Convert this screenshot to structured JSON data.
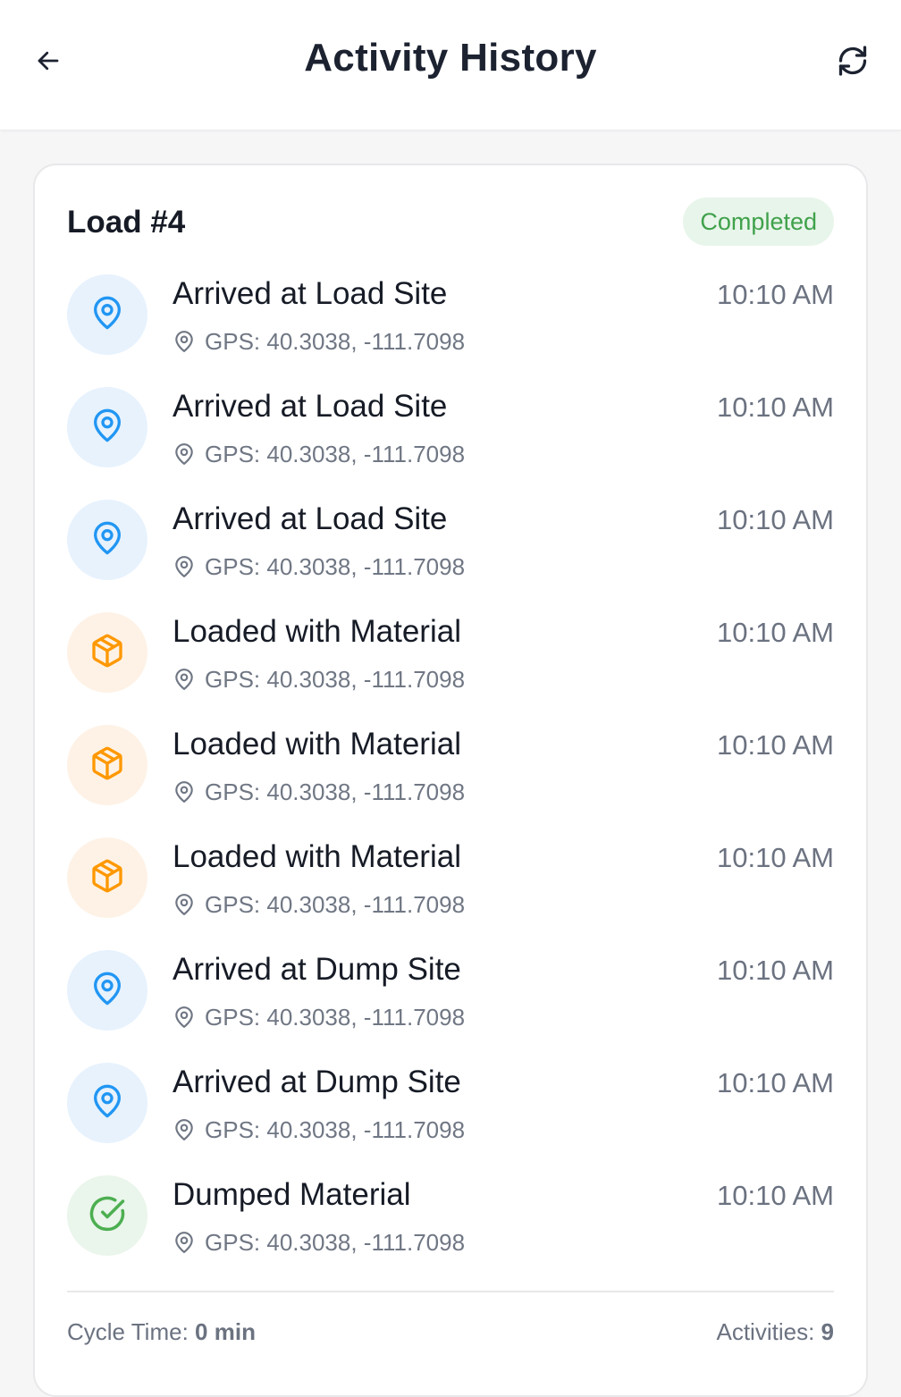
{
  "header": {
    "title": "Activity History",
    "back_icon": "arrow-left-icon",
    "refresh_icon": "refresh-icon"
  },
  "load": {
    "title": "Load #4",
    "status": "Completed",
    "activities": [
      {
        "title": "Arrived at Load Site",
        "time": "10:10 AM",
        "gps": "GPS: 40.3038, -111.7098",
        "icon": "map-pin-icon",
        "color": "blue"
      },
      {
        "title": "Arrived at Load Site",
        "time": "10:10 AM",
        "gps": "GPS: 40.3038, -111.7098",
        "icon": "map-pin-icon",
        "color": "blue"
      },
      {
        "title": "Arrived at Load Site",
        "time": "10:10 AM",
        "gps": "GPS: 40.3038, -111.7098",
        "icon": "map-pin-icon",
        "color": "blue"
      },
      {
        "title": "Loaded with Material",
        "time": "10:10 AM",
        "gps": "GPS: 40.3038, -111.7098",
        "icon": "box-icon",
        "color": "orange"
      },
      {
        "title": "Loaded with Material",
        "time": "10:10 AM",
        "gps": "GPS: 40.3038, -111.7098",
        "icon": "box-icon",
        "color": "orange"
      },
      {
        "title": "Loaded with Material",
        "time": "10:10 AM",
        "gps": "GPS: 40.3038, -111.7098",
        "icon": "box-icon",
        "color": "orange"
      },
      {
        "title": "Arrived at Dump Site",
        "time": "10:10 AM",
        "gps": "GPS: 40.3038, -111.7098",
        "icon": "map-pin-icon",
        "color": "blue"
      },
      {
        "title": "Arrived at Dump Site",
        "time": "10:10 AM",
        "gps": "GPS: 40.3038, -111.7098",
        "icon": "map-pin-icon",
        "color": "blue"
      },
      {
        "title": "Dumped Material",
        "time": "10:10 AM",
        "gps": "GPS: 40.3038, -111.7098",
        "icon": "check-circle-icon",
        "color": "green"
      }
    ],
    "footer": {
      "cycle_label": "Cycle Time:",
      "cycle_value": "0 min",
      "activities_label": "Activities:",
      "activities_value": "9"
    }
  },
  "colors": {
    "blue": "#2196f3",
    "orange": "#ff9800",
    "green": "#4caf50",
    "badge_text": "#3fa14b"
  }
}
